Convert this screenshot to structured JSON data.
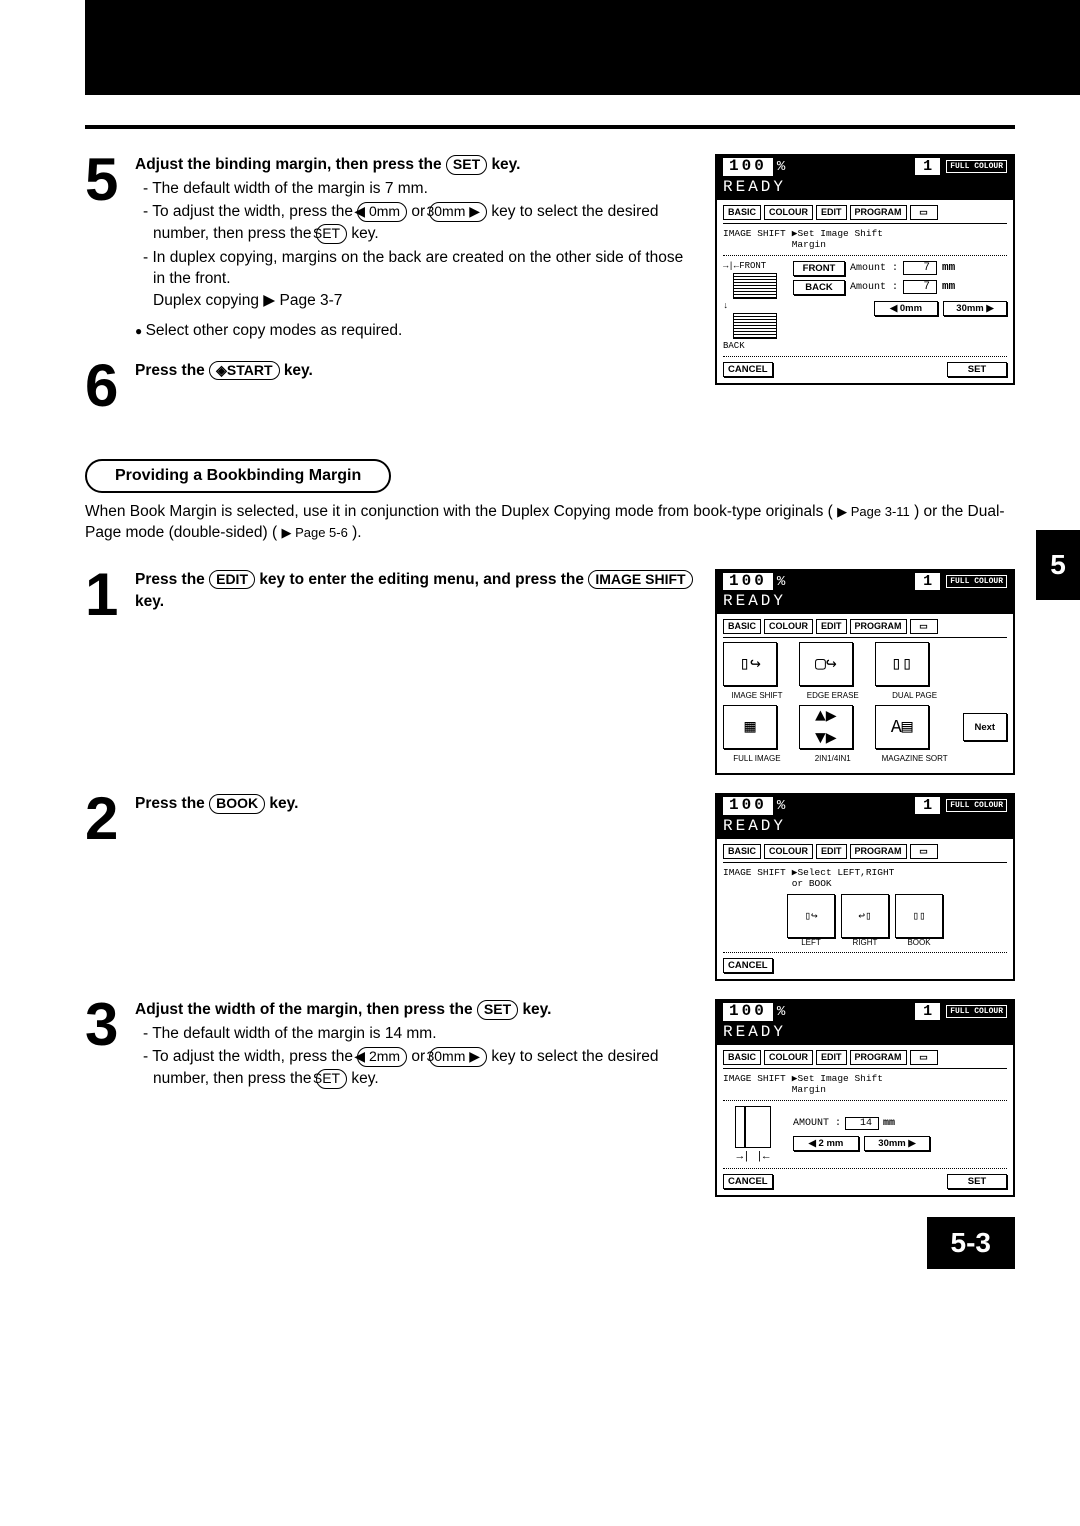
{
  "page_number": "5-3",
  "side_chapter": "5",
  "steps_top": {
    "s5": {
      "num": "5",
      "title_pre": "Adjust the binding margin, then press the",
      "title_key": "SET",
      "title_post": "key.",
      "li1": "The default width of the margin is 7 mm.",
      "li2_pre": "To adjust the width, press the",
      "li2_k1": "◀ 0mm",
      "li2_mid": "or",
      "li2_k2": "30mm ▶",
      "li2_post1": "key to select the desired number, then press the",
      "li2_k3": "SET",
      "li2_post2": "key.",
      "li3_a": "In duplex copying, margins on the back are created on the other side of those in the front.",
      "li3_b": "Duplex copying ▶ Page 3-7",
      "note": "Select other copy modes as required."
    },
    "s6": {
      "num": "6",
      "pre": "Press the",
      "key": "◈START",
      "post": "key."
    }
  },
  "section_title": "Providing a Bookbinding Margin",
  "section_para_pre": "When Book Margin is selected, use it in conjunction with the Duplex Copying mode from book-type originals (",
  "section_para_ref1": "▶ Page 3-11",
  "section_para_mid": ") or the Dual-Page mode (double-sided) (",
  "section_para_ref2": "▶ Page 5-6",
  "section_para_post": ").",
  "steps_mid": {
    "s1": {
      "num": "1",
      "pre": "Press the",
      "k1": "EDIT",
      "mid": "key to enter the editing menu, and press the",
      "k2": "IMAGE SHIFT",
      "post": "key."
    },
    "s2": {
      "num": "2",
      "pre": "Press the",
      "k1": "BOOK",
      "post": "key."
    },
    "s3": {
      "num": "3",
      "title_pre": "Adjust the width of the margin, then press the",
      "title_key": "SET",
      "title_post": "key.",
      "li1": "The default width of the margin is 14 mm.",
      "li2_pre": "To adjust the width, press the",
      "li2_k1": "◀ 2mm",
      "li2_mid": "or",
      "li2_k2": "30mm ▶",
      "li2_post1": "key to select the desired number, then press the",
      "li2_k3": "SET",
      "li2_post2": "key."
    }
  },
  "lcd_common": {
    "zoom": "100",
    "pct": "%",
    "ready": "READY",
    "copies": "1",
    "full_colour": "FULL COLOUR",
    "tabs": {
      "basic": "BASIC",
      "colour": "COLOUR",
      "edit": "EDIT",
      "program": "PROGRAM"
    }
  },
  "lcd1": {
    "breadcrumb": "IMAGE SHIFT",
    "hint": "▶Set Image Shift\nMargin",
    "front_label": "→|←FRONT",
    "back_label": "BACK",
    "btn_front": "FRONT",
    "btn_back": "BACK",
    "amount_label": "Amount :",
    "amount1": "7",
    "amount2": "7",
    "mm": "mm",
    "btn_0mm": "◀   0mm",
    "btn_30mm": "30mm  ▶",
    "cancel": "CANCEL",
    "set": "SET"
  },
  "lcd2": {
    "items": {
      "image_shift": "IMAGE SHIFT",
      "edge_erase": "EDGE ERASE",
      "dual_page": "DUAL PAGE",
      "full_image": "FULL IMAGE",
      "two_in_one": "2IN1/4IN1",
      "magazine": "MAGAZINE SORT"
    },
    "next": "Next"
  },
  "lcd3": {
    "breadcrumb": "IMAGE SHIFT",
    "hint": "▶Select LEFT,RIGHT\nor BOOK",
    "left": "LEFT",
    "right": "RIGHT",
    "book": "BOOK",
    "cancel": "CANCEL"
  },
  "lcd4": {
    "breadcrumb": "IMAGE SHIFT",
    "hint": "▶Set Image Shift\nMargin",
    "amount_label": "AMOUNT :",
    "amount": "14",
    "mm": "mm",
    "btn_2mm": "◀  2 mm",
    "btn_30mm": "30mm  ▶",
    "cancel": "CANCEL",
    "set": "SET"
  }
}
